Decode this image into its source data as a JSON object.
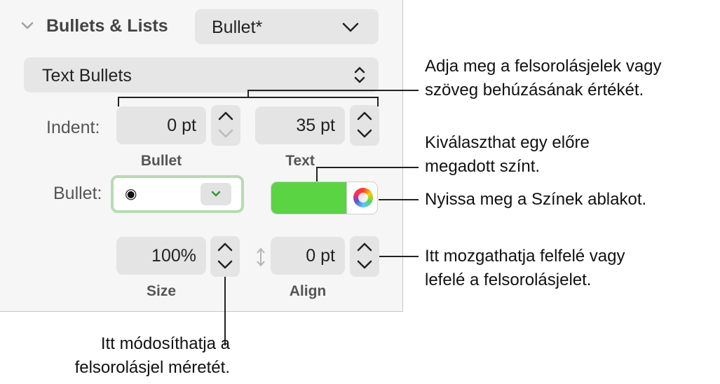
{
  "section": {
    "title": "Bullets & Lists",
    "style_value": "Bullet*"
  },
  "bullet_type": {
    "value": "Text Bullets"
  },
  "indent": {
    "label": "Indent:",
    "bullet_value": "0 pt",
    "bullet_label": "Bullet",
    "text_value": "35 pt",
    "text_label": "Text"
  },
  "bullet": {
    "label": "Bullet:",
    "glyph": "◉",
    "color_swatch": "#5ad443"
  },
  "size": {
    "value": "100%",
    "label": "Size"
  },
  "align": {
    "value": "0 pt",
    "label": "Align"
  },
  "callouts": {
    "indent_1": "Adja meg a felsorolásjelek vagy",
    "indent_2": "szöveg behúzásának értékét.",
    "preset_1": "Kiválaszthat egy előre",
    "preset_2": "megadott színt.",
    "colors": "Nyissa meg a Színek ablakot.",
    "move_1": "Itt mozgathatja felfelé vagy",
    "move_2": "lefelé a felsorolásjelet.",
    "size_1": "Itt módosíthatja a",
    "size_2": "felsorolásjel méretét."
  }
}
